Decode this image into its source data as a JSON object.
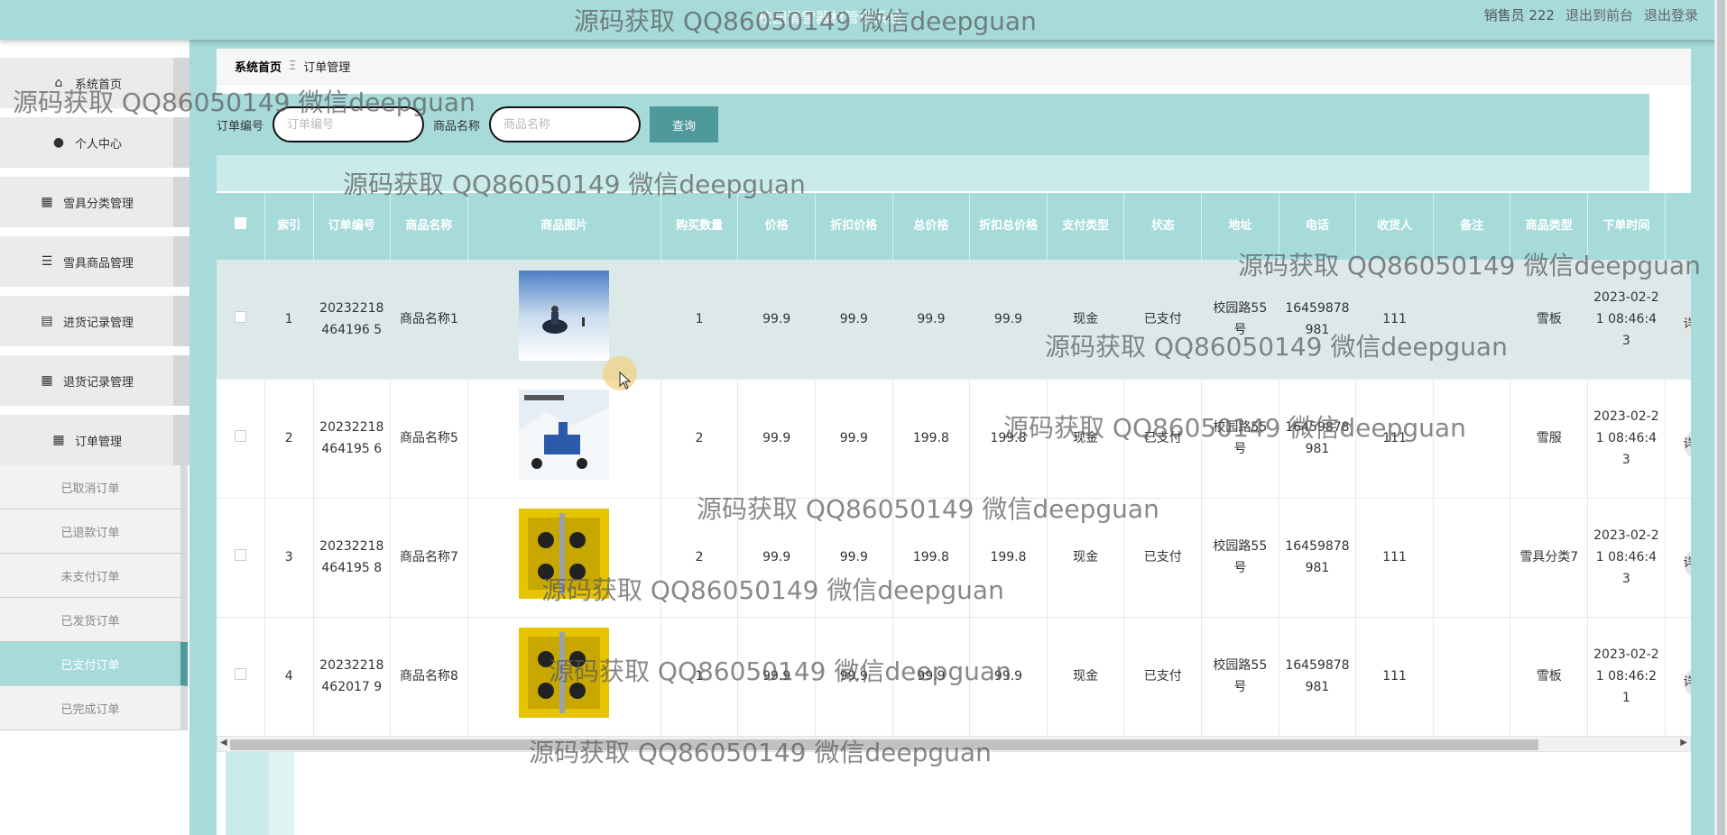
{
  "header": {
    "title": "校园滑雪器材管理系统",
    "user_label": "销售员 222",
    "to_front": "退出到前台",
    "logout": "退出登录"
  },
  "sidebar": {
    "items": [
      {
        "label": "系统首页",
        "icon": "home-icon"
      },
      {
        "label": "个人中心",
        "icon": "user-icon"
      },
      {
        "label": "雪具分类管理",
        "icon": "grid-icon"
      },
      {
        "label": "雪具商品管理",
        "icon": "list-icon"
      },
      {
        "label": "进货记录管理",
        "icon": "clipboard-icon"
      },
      {
        "label": "退货记录管理",
        "icon": "grid-icon"
      },
      {
        "label": "订单管理",
        "icon": "grid-icon"
      }
    ],
    "submenu": [
      "已取消订单",
      "已退款订单",
      "未支付订单",
      "已发货订单",
      "已支付订单",
      "已完成订单"
    ],
    "active_sub": "已支付订单"
  },
  "breadcrumb": {
    "home": "系统首页",
    "sep": "Ξ",
    "current": "订单管理"
  },
  "search": {
    "order_label": "订单编号",
    "order_placeholder": "订单编号",
    "name_label": "商品名称",
    "name_placeholder": "商品名称",
    "query_button": "查询"
  },
  "table": {
    "columns": [
      "索引",
      "订单编号",
      "商品名称",
      "商品图片",
      "购买数量",
      "价格",
      "折扣价格",
      "总价格",
      "折扣总价格",
      "支付类型",
      "状态",
      "地址",
      "电话",
      "收货人",
      "备注",
      "商品类型",
      "下单时间"
    ],
    "rows": [
      {
        "index": "1",
        "order_no": "20232218464196 5",
        "name": "商品名称1",
        "qty": "1",
        "price": "99.9",
        "discount_price": "99.9",
        "total": "99.9",
        "discount_total": "99.9",
        "pay_type": "现金",
        "status": "已支付",
        "address": "校园路55号",
        "phone": "16459878981",
        "receiver": "111",
        "remark": "",
        "category": "雪板",
        "time": "2023-02-21 08:46:43"
      },
      {
        "index": "2",
        "order_no": "20232218464195 6",
        "name": "商品名称5",
        "qty": "2",
        "price": "99.9",
        "discount_price": "99.9",
        "total": "199.8",
        "discount_total": "199.8",
        "pay_type": "现金",
        "status": "已支付",
        "address": "校园路55号",
        "phone": "16459878981",
        "receiver": "111",
        "remark": "",
        "category": "雪服",
        "time": "2023-02-21 08:46:43"
      },
      {
        "index": "3",
        "order_no": "20232218464195 8",
        "name": "商品名称7",
        "qty": "2",
        "price": "99.9",
        "discount_price": "99.9",
        "total": "199.8",
        "discount_total": "199.8",
        "pay_type": "现金",
        "status": "已支付",
        "address": "校园路55号",
        "phone": "16459878981",
        "receiver": "111",
        "remark": "",
        "category": "雪具分类7",
        "time": "2023-02-21 08:46:43"
      },
      {
        "index": "4",
        "order_no": "20232218462017 9",
        "name": "商品名称8",
        "qty": "1",
        "price": "99.9",
        "discount_price": "99.9",
        "total": "99.9",
        "discount_total": "99.9",
        "pay_type": "现金",
        "status": "已支付",
        "address": "校园路55号",
        "phone": "16459878981",
        "receiver": "111",
        "remark": "",
        "category": "雪板",
        "time": "2023-02-21 08:46:21"
      }
    ],
    "detail_button": "详情"
  },
  "watermark": "源码获取 QQ86050149 微信deepguan",
  "colors": {
    "accent": "#a6dbda",
    "button": "#4e9a9a",
    "row_highlight": "#dde9e9"
  }
}
